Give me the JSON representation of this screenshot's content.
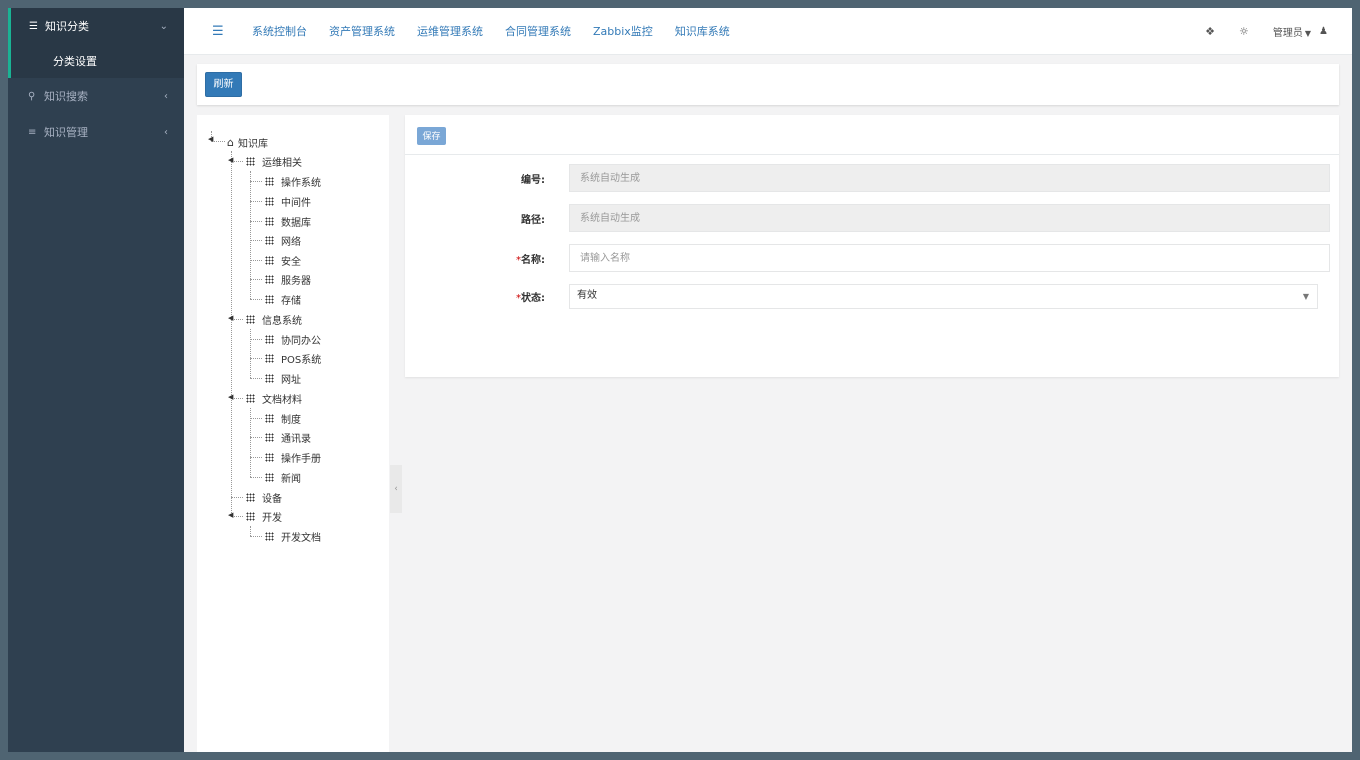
{
  "sidebar": {
    "groups": [
      {
        "label": "知识分类",
        "icon": "list-icon",
        "arrow": "chevron-down-icon",
        "active": true,
        "children": [
          {
            "label": "分类设置"
          }
        ]
      },
      {
        "label": "知识搜索",
        "icon": "search-icon",
        "arrow": "chevron-left-icon"
      },
      {
        "label": "知识管理",
        "icon": "bars-icon",
        "arrow": "chevron-left-icon"
      }
    ]
  },
  "topbar": {
    "links": [
      "系统控制台",
      "资产管理系统",
      "运维管理系统",
      "合同管理系统",
      "Zabbix监控",
      "知识库系统"
    ],
    "user": "管理员"
  },
  "toolbar": {
    "refresh_label": "刷新"
  },
  "tree": {
    "root": "知识库",
    "nodes": [
      {
        "label": "运维相关",
        "children": [
          "操作系统",
          "中间件",
          "数据库",
          "网络",
          "安全",
          "服务器",
          "存储"
        ]
      },
      {
        "label": "信息系统",
        "children": [
          "协同办公",
          "POS系统",
          "网址"
        ]
      },
      {
        "label": "文档材料",
        "children": [
          "制度",
          "通讯录",
          "操作手册",
          "新闻"
        ]
      },
      {
        "label": "设备",
        "children": []
      },
      {
        "label": "开发",
        "children": [
          "开发文档"
        ]
      }
    ]
  },
  "form": {
    "save_label": "保存",
    "fields": {
      "code": {
        "label": "编号:",
        "placeholder": "系统自动生成"
      },
      "path": {
        "label": "路径:",
        "placeholder": "系统自动生成"
      },
      "name": {
        "required": "*",
        "label": "名称:",
        "placeholder": "请输入名称"
      },
      "status": {
        "required": "*",
        "label": "状态:",
        "value": "有效"
      }
    }
  }
}
